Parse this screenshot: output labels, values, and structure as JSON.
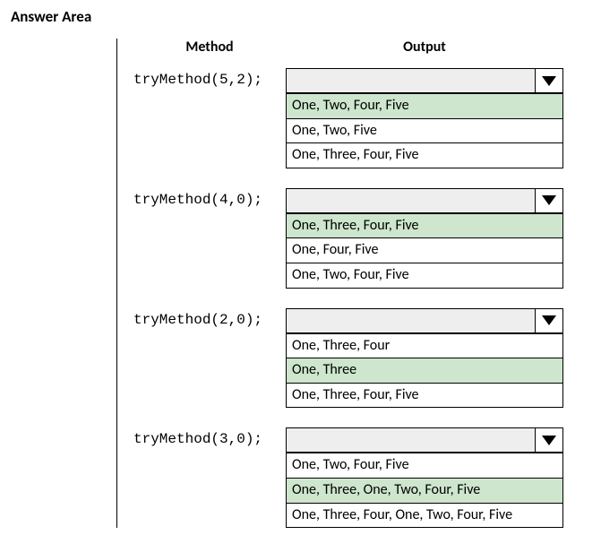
{
  "title": "Answer Area",
  "headers": {
    "method": "Method",
    "output": "Output"
  },
  "questions": [
    {
      "method": "tryMethod(5,2);",
      "options": [
        "One, Two, Four, Five",
        "One, Two, Five",
        "One, Three, Four, Five"
      ],
      "selected_index": 0
    },
    {
      "method": "tryMethod(4,0);",
      "options": [
        "One, Three, Four, Five",
        "One, Four, Five",
        "One, Two, Four, Five"
      ],
      "selected_index": 0
    },
    {
      "method": "tryMethod(2,0);",
      "options": [
        "One, Three, Four",
        "One, Three",
        "One, Three, Four, Five"
      ],
      "selected_index": 1
    },
    {
      "method": "tryMethod(3,0);",
      "options": [
        "One, Two, Four, Five",
        "One, Three, One, Two, Four, Five",
        "One, Three, Four, One, Two, Four, Five"
      ],
      "selected_index": 1
    }
  ]
}
